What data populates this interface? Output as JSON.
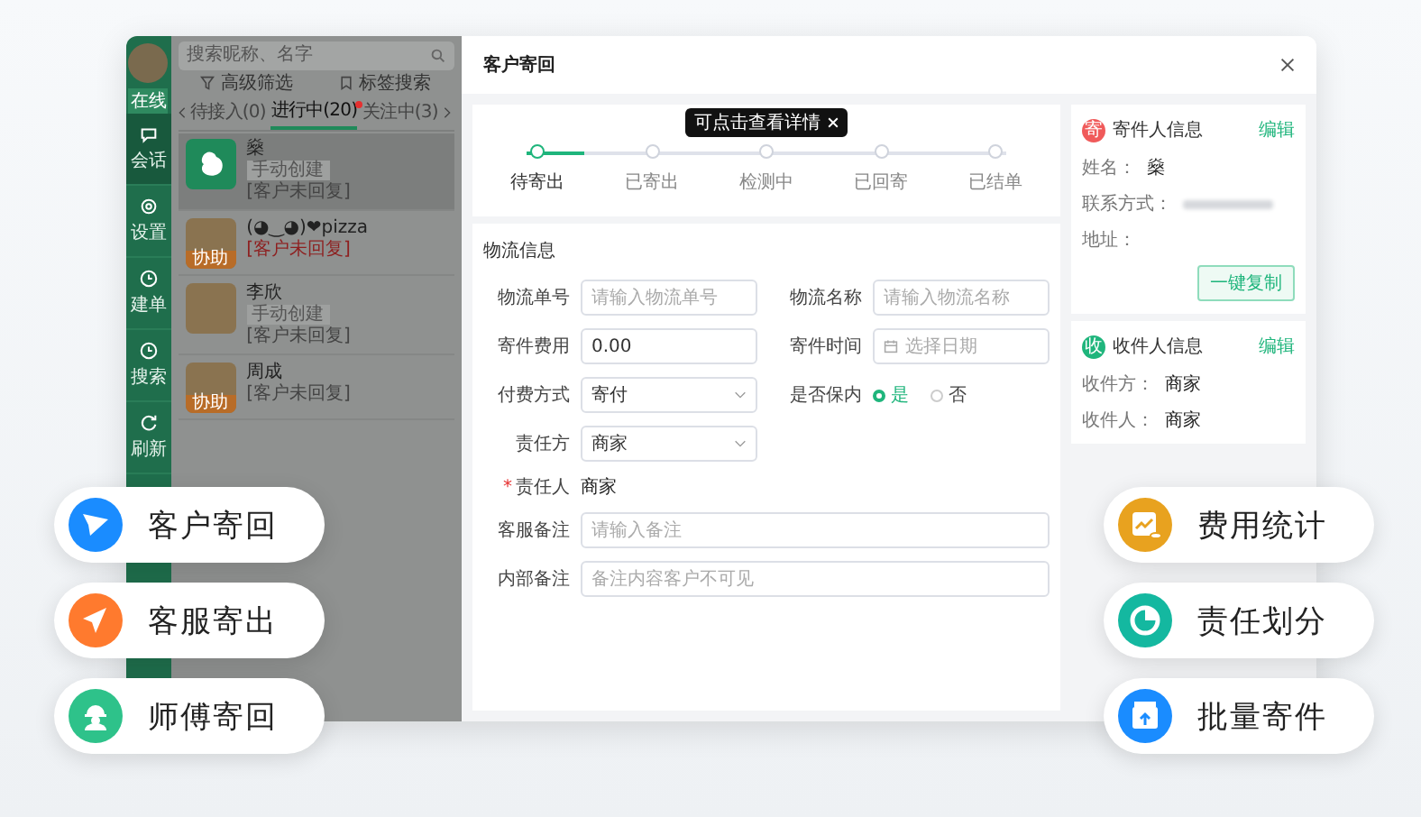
{
  "sidebar": {
    "status": "在线",
    "items": [
      {
        "label": "会话",
        "selected": true,
        "kind": "chat"
      },
      {
        "label": "设置",
        "selected": false,
        "kind": "gear"
      },
      {
        "label": "建单",
        "selected": false,
        "kind": "clock"
      },
      {
        "label": "搜索",
        "selected": false,
        "kind": "clock"
      },
      {
        "label": "刷新",
        "selected": false,
        "kind": "refresh"
      }
    ]
  },
  "chat_list": {
    "search": {
      "placeholder": "搜索昵称、名字"
    },
    "filters": [
      {
        "label": "高级筛选",
        "kind": "filter"
      },
      {
        "label": "标签搜索",
        "kind": "tag"
      }
    ],
    "tabs": [
      {
        "label": "待接入(0)",
        "selected": false,
        "unread": false
      },
      {
        "label": "进行中(20)",
        "selected": true,
        "unread": true
      },
      {
        "label": "关注中(3)",
        "selected": false,
        "unread": false
      }
    ],
    "items": [
      {
        "name": "燊",
        "kind": "logo",
        "selected": true,
        "tag": "手动创建",
        "note": "[客户未回复]",
        "alert": false
      },
      {
        "name": "(◕‿◕)❤pizza",
        "kind": "photo",
        "selected": false,
        "assist": "协助",
        "note": "[客户未回复]",
        "alert": true
      },
      {
        "name": "李欣",
        "kind": "photo",
        "selected": false,
        "tag": "手动创建",
        "note": "[客户未回复]",
        "alert": false
      },
      {
        "name": "周成",
        "kind": "photo",
        "selected": false,
        "assist": "协助",
        "note": "[客户未回复]",
        "alert": false
      }
    ]
  },
  "modal": {
    "title": "客户寄回",
    "stepper": {
      "level": 0.12,
      "tooltip": "可点击查看详情",
      "steps": [
        {
          "label": "待寄出",
          "selected": true
        },
        {
          "label": "已寄出",
          "selected": false
        },
        {
          "label": "检测中",
          "selected": false
        },
        {
          "label": "已回寄",
          "selected": false
        },
        {
          "label": "已结单",
          "selected": false
        }
      ]
    },
    "section": "物流信息",
    "rows": [
      [
        {
          "label": "物流单号",
          "kind": "input",
          "placeholder": "请输入物流单号"
        },
        {
          "label": "物流名称",
          "kind": "input",
          "placeholder": "请输入物流名称"
        }
      ],
      [
        {
          "label": "寄件费用",
          "kind": "input",
          "value": "0.00"
        },
        {
          "label": "寄件时间",
          "kind": "date",
          "placeholder": "选择日期"
        }
      ],
      [
        {
          "label": "付费方式",
          "kind": "select",
          "value": "寄付"
        },
        {
          "label": "是否保内",
          "kind": "radio",
          "options": [
            {
              "label": "是",
              "selected": true
            },
            {
              "label": "否",
              "selected": false
            }
          ]
        }
      ],
      [
        {
          "label": "责任方",
          "kind": "select",
          "value": "商家"
        }
      ],
      [
        {
          "label": "责任人",
          "kind": "text",
          "value": "商家",
          "required_mark": "*"
        }
      ],
      [
        {
          "label": "客服备注",
          "kind": "input",
          "wide": true,
          "placeholder": "请输入备注"
        }
      ],
      [
        {
          "label": "内部备注",
          "kind": "input",
          "wide": true,
          "placeholder": "备注内容客户不可见"
        }
      ]
    ],
    "sender": {
      "title": "寄件人信息",
      "badge": "寄",
      "color": "#f05a5a",
      "action": "编辑",
      "rows": [
        {
          "label": "姓名：",
          "value": "燊"
        },
        {
          "label": "联系方式：",
          "blurred": true
        },
        {
          "label": "地址："
        }
      ],
      "copy": "一键复制"
    },
    "receiver": {
      "title": "收件人信息",
      "badge": "收",
      "color": "#1fb57c",
      "action": "编辑",
      "rows": [
        {
          "label": "收件方：",
          "value": "商家"
        },
        {
          "label": "收件人：",
          "value": "商家"
        }
      ]
    }
  },
  "features_left": [
    {
      "label": "客户寄回",
      "kind": "plane",
      "color": "#1a8cff"
    },
    {
      "label": "客服寄出",
      "kind": "send",
      "color": "#ff7a2e"
    },
    {
      "label": "师傅寄回",
      "kind": "worker",
      "color": "#2ec28a"
    }
  ],
  "features_right": [
    {
      "label": "费用统计",
      "kind": "chart",
      "color": "#e8a21f"
    },
    {
      "label": "责任划分",
      "kind": "pie",
      "color": "#14b8a0"
    },
    {
      "label": "批量寄件",
      "kind": "box",
      "color": "#1a8cff"
    }
  ]
}
